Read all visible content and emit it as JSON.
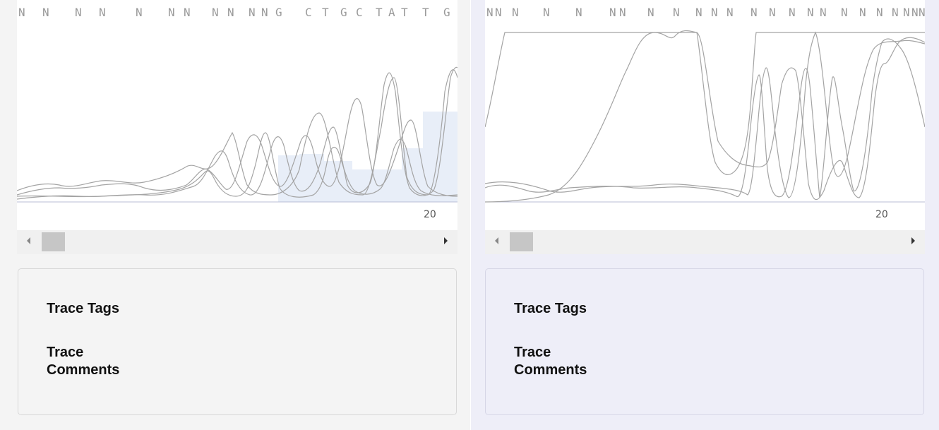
{
  "panels": [
    {
      "id": "left",
      "base_calls": [
        "N",
        "N",
        "N",
        "N",
        "N",
        "N",
        "N",
        "N",
        "N",
        "N",
        "N",
        "G",
        "C",
        "T",
        "G",
        "C",
        "T",
        "A",
        "T",
        "T",
        "G"
      ],
      "position_label": "20",
      "info": {
        "tags_label": "Trace Tags",
        "comments_label": "Trace Comments"
      }
    },
    {
      "id": "right",
      "base_calls": [
        "N",
        "N",
        "N",
        "N",
        "N",
        "N",
        "N",
        "N",
        "N",
        "N",
        "N",
        "N",
        "N",
        "N",
        "N",
        "N",
        "N",
        "N",
        "N",
        "N",
        "N",
        "N",
        "N",
        "N"
      ],
      "position_label": "20",
      "info": {
        "tags_label": "Trace Tags",
        "comments_label": "Trace Comments"
      }
    }
  ],
  "colors": {
    "left_panel_bg": "#f4f4f4",
    "right_panel_bg": "#eeeef8",
    "trace_line": "#a4a4a4",
    "quality_bar": "#e8eef8",
    "base_call_text": "#9a9a9a"
  },
  "icons": {
    "scroll_left": "left-triangle",
    "scroll_right": "right-triangle"
  }
}
